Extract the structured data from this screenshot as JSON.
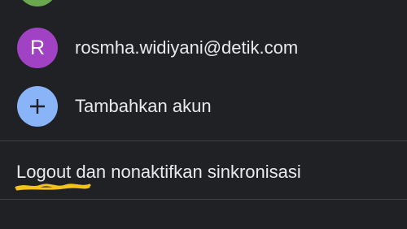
{
  "accounts": [
    {
      "avatar_color": "#6aa84f"
    },
    {
      "initial": "R",
      "email": "rosmha.widiyani@detik.com",
      "avatar_color": "#a142c4"
    }
  ],
  "add_account": {
    "icon": "plus-icon",
    "label": "Tambahkan akun",
    "avatar_color": "#8ab4f8",
    "icon_color": "#202124"
  },
  "logout": {
    "label": "Logout dan nonaktifkan sinkronisasi"
  },
  "colors": {
    "background": "#202124",
    "text": "#e8eaed",
    "divider": "#3c4043",
    "highlight": "#f3c21b"
  }
}
